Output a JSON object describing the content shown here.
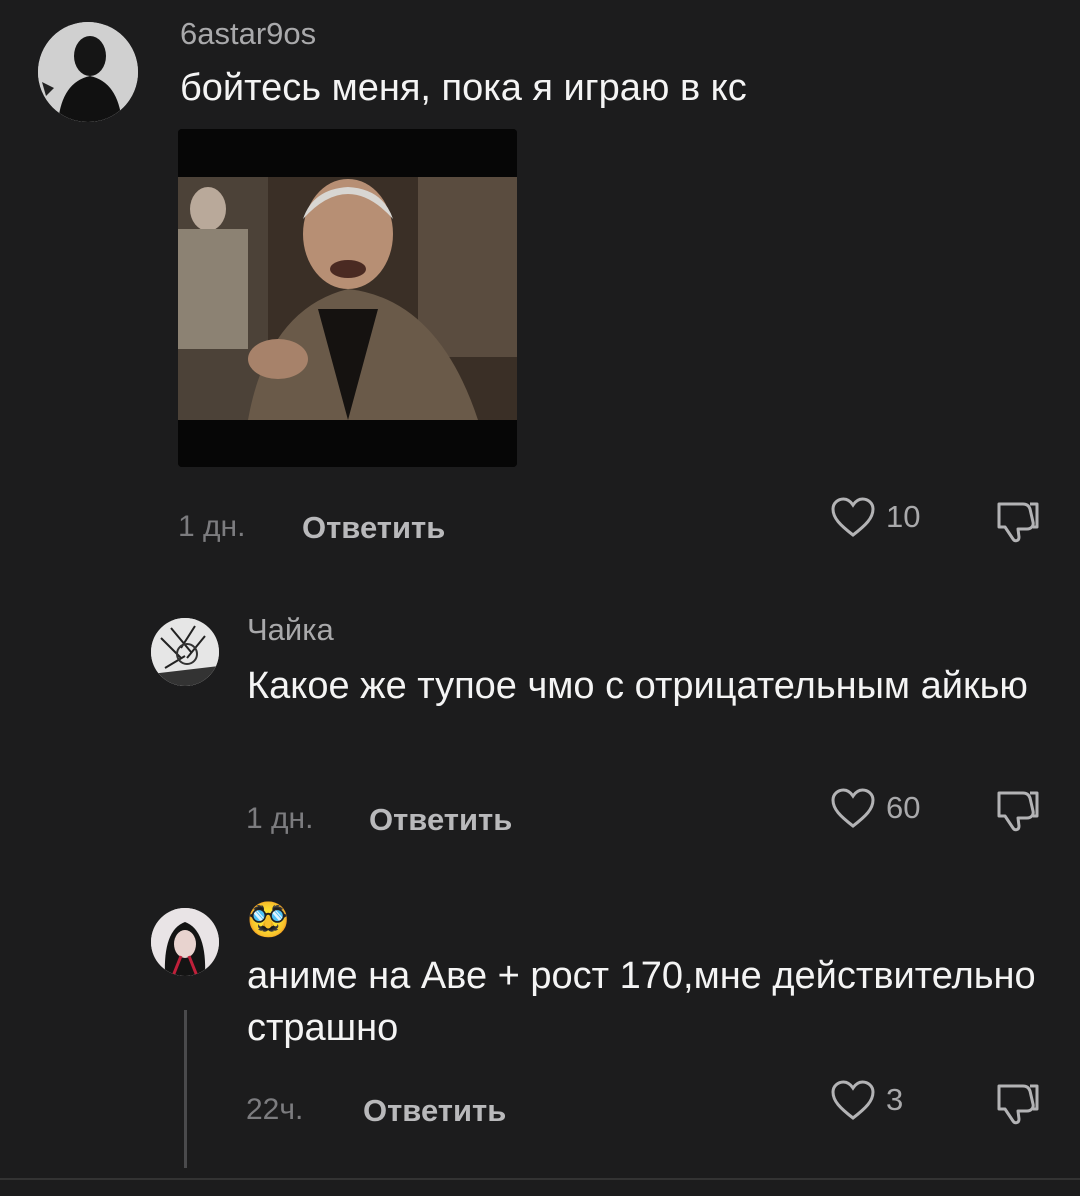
{
  "comments": [
    {
      "username": "6astar9os",
      "text": "бойтесь меня, пока я играю в кс",
      "time": "1 дн.",
      "reply_label": "Ответить",
      "likes": "10"
    },
    {
      "username": "Чайка",
      "text": "Какое же тупое чмо с отрицательным айкью",
      "time": "1 дн.",
      "reply_label": "Ответить",
      "likes": "60"
    },
    {
      "username": "🥸",
      "text": "аниме на Аве + рост 170,мне действительно страшно",
      "time": "22ч.",
      "reply_label": "Ответить",
      "likes": "3"
    }
  ],
  "icons": {
    "like": "heart-outline-icon",
    "dislike": "thumbs-down-outline-icon"
  },
  "colors": {
    "background": "#1c1c1d",
    "primary_text": "#f4f4f4",
    "secondary_text": "#a9a9ab"
  }
}
